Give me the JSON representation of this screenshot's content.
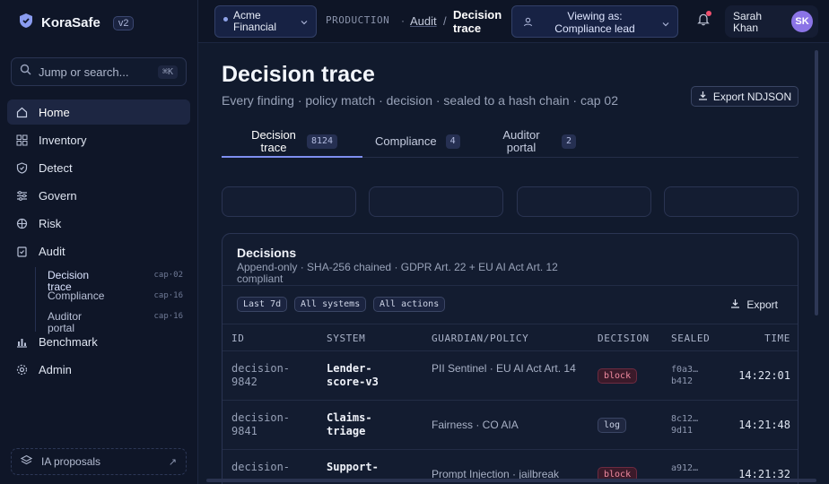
{
  "app": {
    "name": "KoraSafe",
    "version": "v2",
    "accent": "#7e8ef0"
  },
  "search": {
    "placeholder": "Jump or search...",
    "shortcut": "⌘K"
  },
  "sidebar": {
    "items": [
      {
        "label": "Home",
        "icon": "home-icon"
      },
      {
        "label": "Inventory",
        "icon": "grid-icon"
      },
      {
        "label": "Detect",
        "icon": "shield-check-icon"
      },
      {
        "label": "Govern",
        "icon": "sliders-icon"
      },
      {
        "label": "Risk",
        "icon": "crosshair-icon"
      },
      {
        "label": "Audit",
        "icon": "clipboard-icon"
      },
      {
        "label": "Benchmark",
        "icon": "bar-chart-icon"
      },
      {
        "label": "Admin",
        "icon": "gear-icon"
      }
    ],
    "audit_sub": [
      {
        "label": "Decision trace",
        "tag": "cap·02"
      },
      {
        "label": "Compliance",
        "tag": "cap·16"
      },
      {
        "label": "Auditor portal",
        "tag": "cap·16"
      }
    ],
    "ia_proposals": "IA proposals"
  },
  "topbar": {
    "org": "Acme Financial",
    "env": "PRODUCTION",
    "crumb_sep": "·",
    "crumb_audit": "Audit",
    "crumb_slash": "/",
    "crumb_current": "Decision trace",
    "viewing_line1": "Viewing as:",
    "viewing_line2": "Compliance lead",
    "user_first": "Sarah",
    "user_last": "Khan",
    "avatar_initials": "SK"
  },
  "page": {
    "title": "Decision trace",
    "subtitle": "Every finding · policy match · decision · sealed to a hash chain · cap 02",
    "export_ndjson": "Export NDJSON"
  },
  "tabs": [
    {
      "label": "Decision trace",
      "count": "8124"
    },
    {
      "label": "Compliance",
      "count": "4"
    },
    {
      "label": "Auditor portal",
      "count": "2"
    }
  ],
  "panel": {
    "title": "Decisions",
    "subtitle": "Append-only · SHA-256 chained · GDPR Art. 22 + EU AI Act Art. 12 compliant",
    "filters": [
      "Last 7d",
      "All systems",
      "All actions"
    ],
    "export": "Export",
    "columns": [
      "ID",
      "SYSTEM",
      "GUARDIAN/POLICY",
      "DECISION",
      "SEALED",
      "TIME"
    ],
    "rows": [
      {
        "id": "decision-9842",
        "system": "Lender-score-v3",
        "policy": "PII Sentinel · EU AI Act Art. 14",
        "decision": "block",
        "sealed": "f0a3… b412",
        "time": "14:22:01"
      },
      {
        "id": "decision-9841",
        "system": "Claims-triage",
        "policy": "Fairness · CO AIA",
        "decision": "log",
        "sealed": "8c12… 9d11",
        "time": "14:21:48"
      },
      {
        "id": "decision-",
        "system": "Support-",
        "policy": "Prompt Injection · jailbreak",
        "decision": "block",
        "sealed": "a912…",
        "time": "14:21:32"
      }
    ]
  }
}
